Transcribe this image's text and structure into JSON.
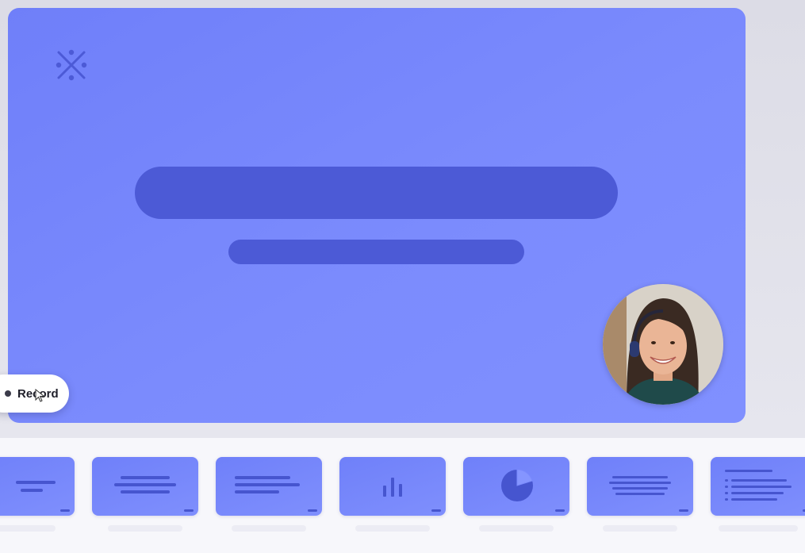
{
  "record_button": {
    "label": "Record"
  },
  "icons": {
    "logo": "sparkle-x-logo-icon",
    "record": "record-dot-icon",
    "cursor": "mouse-pointer-icon"
  },
  "colors": {
    "slide_accent": "#4c5ad6",
    "slide_background": "#7b8bfd",
    "tray_background": "#f7f7fb"
  },
  "thumbnails": [
    {
      "kind": "text-lines"
    },
    {
      "kind": "text-lines"
    },
    {
      "kind": "text-lines"
    },
    {
      "kind": "bar-chart"
    },
    {
      "kind": "pie-chart"
    },
    {
      "kind": "text-lines"
    },
    {
      "kind": "bullet-list"
    }
  ]
}
